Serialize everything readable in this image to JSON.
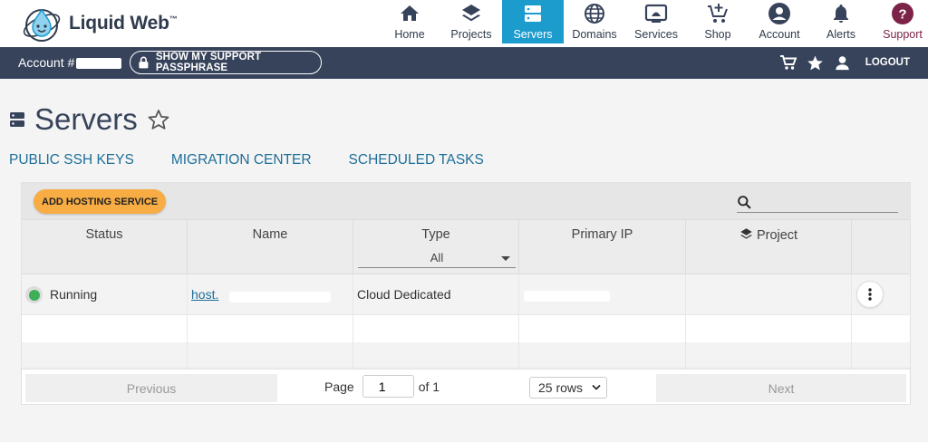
{
  "app": {
    "brand": "Liquid Web",
    "brand_tm": "™"
  },
  "nav": {
    "items": [
      {
        "label": "Home",
        "icon": "home-icon"
      },
      {
        "label": "Projects",
        "icon": "layers-icon"
      },
      {
        "label": "Servers",
        "icon": "server-icon",
        "active": true
      },
      {
        "label": "Domains",
        "icon": "globe-icon"
      },
      {
        "label": "Services",
        "icon": "monitor-icon"
      },
      {
        "label": "Shop",
        "icon": "cart-plus-icon"
      },
      {
        "label": "Account",
        "icon": "account-circle-icon"
      },
      {
        "label": "Alerts",
        "icon": "bell-icon"
      },
      {
        "label": "Support",
        "icon": "help-circle-icon"
      }
    ]
  },
  "account_bar": {
    "account_label": "Account #",
    "passphrase_button": "SHOW MY SUPPORT PASSPHRASE",
    "logout_label": "LOGOUT"
  },
  "page": {
    "title": "Servers",
    "subnav": [
      "PUBLIC SSH KEYS",
      "MIGRATION CENTER",
      "SCHEDULED TASKS"
    ]
  },
  "table": {
    "add_button": "ADD HOSTING SERVICE",
    "search_placeholder": "",
    "columns": [
      "Status",
      "Name",
      "Type",
      "Primary IP",
      "Project",
      ""
    ],
    "type_filter": "All",
    "rows": [
      {
        "status": "Running",
        "status_color": "#3daf57",
        "name": "host.",
        "type": "Cloud Dedicated",
        "primary_ip": "",
        "project": ""
      }
    ]
  },
  "pagination": {
    "previous": "Previous",
    "page_label": "Page",
    "page_value": "1",
    "of_label": "of 1",
    "rows_option": "25 rows",
    "next": "Next"
  },
  "colors": {
    "accent": "#1c9bcd",
    "header_bar": "#37435b",
    "add_button": "#f8ac44",
    "support": "#7b2348",
    "link": "#1d6e98"
  }
}
